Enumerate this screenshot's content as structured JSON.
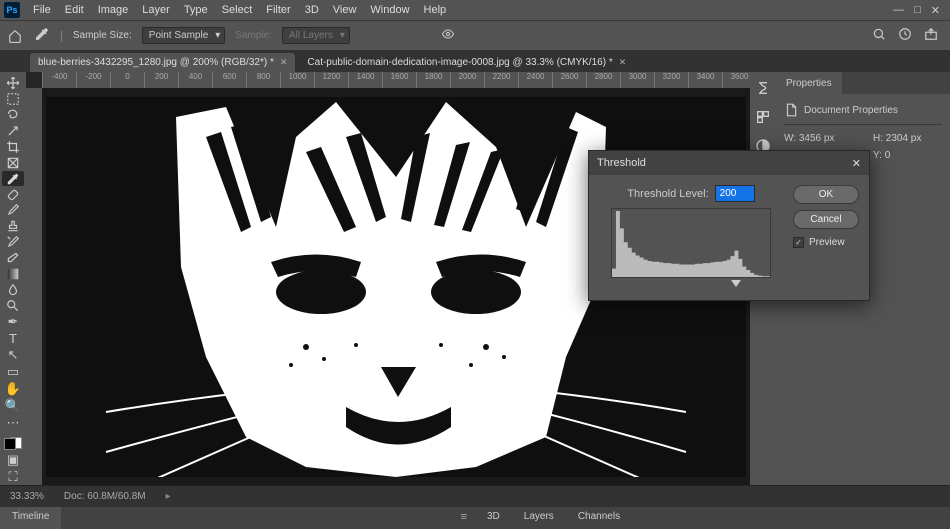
{
  "app": {
    "logo": "Ps"
  },
  "menubar": [
    "File",
    "Edit",
    "Image",
    "Layer",
    "Type",
    "Select",
    "Filter",
    "3D",
    "View",
    "Window",
    "Help"
  ],
  "optionsbar": {
    "sample_size_label": "Sample Size:",
    "sample_size_value": "Point Sample",
    "sample_label": "Sample:",
    "sample_value": "All Layers"
  },
  "tabs": [
    {
      "title": "blue-berries-3432295_1280.jpg @ 200% (RGB/32*) *",
      "active": false
    },
    {
      "title": "Cat-public-domain-dedication-image-0008.jpg @ 33.3% (CMYK/16) *",
      "active": true
    }
  ],
  "ruler_marks": [
    "-400",
    "-200",
    "0",
    "200",
    "400",
    "600",
    "800",
    "1000",
    "1200",
    "1400",
    "1600",
    "1800",
    "2000",
    "2200",
    "2400",
    "2600",
    "2800",
    "3000",
    "3200",
    "3400",
    "3600"
  ],
  "tools": [
    "move",
    "marquee",
    "lasso",
    "wand",
    "crop",
    "frame",
    "eyedropper",
    "heal",
    "brush",
    "stamp",
    "history-brush",
    "eraser",
    "gradient",
    "blur",
    "dodge",
    "pen",
    "type",
    "path",
    "rect",
    "hand",
    "zoom"
  ],
  "properties": {
    "tab": "Properties",
    "header": "Document Properties",
    "w_label": "W:",
    "w_value": "3456 px",
    "h_label": "H:",
    "h_value": "2304 px",
    "x_label": "X:",
    "x_value": "0",
    "y_label": "Y:",
    "y_value": "0"
  },
  "status": {
    "zoom": "33.33%",
    "doc": "Doc: 60.8M/60.8M"
  },
  "timeline_tab": "Timeline",
  "panel_tabs": [
    "3D",
    "Layers",
    "Channels"
  ],
  "dialog": {
    "title": "Threshold",
    "level_label": "Threshold Level:",
    "level_value": "200",
    "ok": "OK",
    "cancel": "Cancel",
    "preview": "Preview",
    "preview_checked": true,
    "histogram_values": [
      12,
      95,
      70,
      50,
      42,
      35,
      31,
      28,
      25,
      23,
      22,
      22,
      21,
      20,
      20,
      19,
      19,
      18,
      18,
      18,
      18,
      19,
      19,
      20,
      20,
      21,
      22,
      22,
      23,
      25,
      30,
      38,
      26,
      15,
      10,
      6,
      3,
      2,
      1,
      1
    ],
    "slider_position_pct": 78
  }
}
